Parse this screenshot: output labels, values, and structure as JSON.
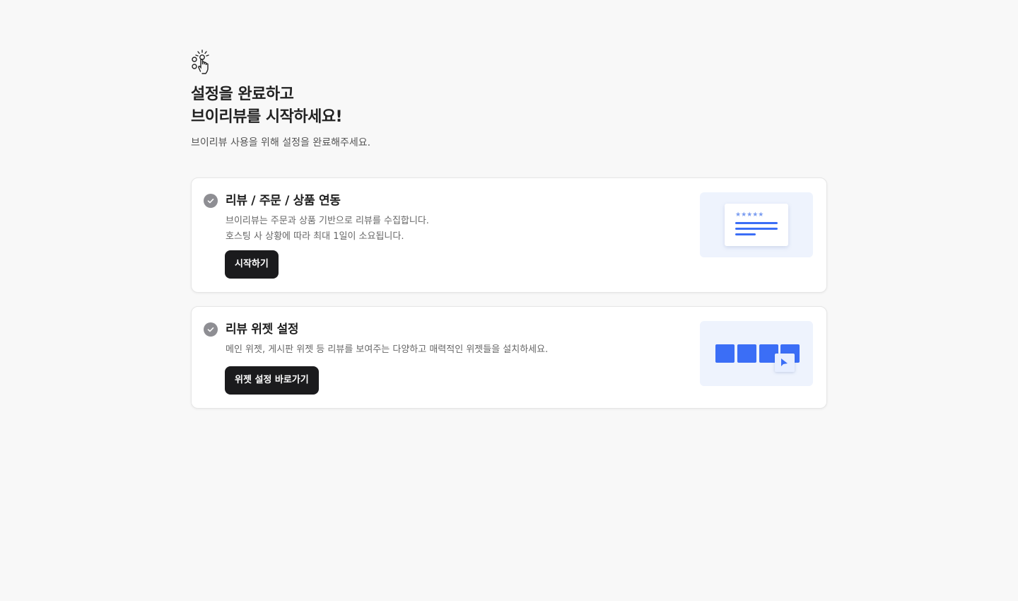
{
  "header": {
    "icon": "hand-tap-icon",
    "title_line1": "설정을 완료하고",
    "title_line2": "브이리뷰를 시작하세요!",
    "subtitle": "브이리뷰 사용을 위해 설정을 완료해주세요."
  },
  "cards": [
    {
      "icon": "check-circle-icon",
      "title": "리뷰 / 주문 / 상품 연동",
      "desc_line1": "브이리뷰는 주문과 상품 기반으로 리뷰를 수집합니다.",
      "desc_line2": "호스팅 사 상황에 따라 최대 1일이 소요됩니다.",
      "button_label": "시작하기",
      "illustration": "review-card-illustration"
    },
    {
      "icon": "check-circle-icon",
      "title": "리뷰 위젯 설정",
      "desc_line1": "메인 위젯, 게시판 위젯 등 리뷰를 보여주는 다양하고 매력적인 위젯들을 설치하세요.",
      "button_label": "위젯 설정 바로가기",
      "illustration": "widget-grid-illustration"
    }
  ],
  "colors": {
    "background": "#f8f8f8",
    "button": "#1b1b1d",
    "accent_blue": "#3b6ef6",
    "check_gray": "#8e8e93",
    "illustration_bg": "#eef3fd"
  }
}
